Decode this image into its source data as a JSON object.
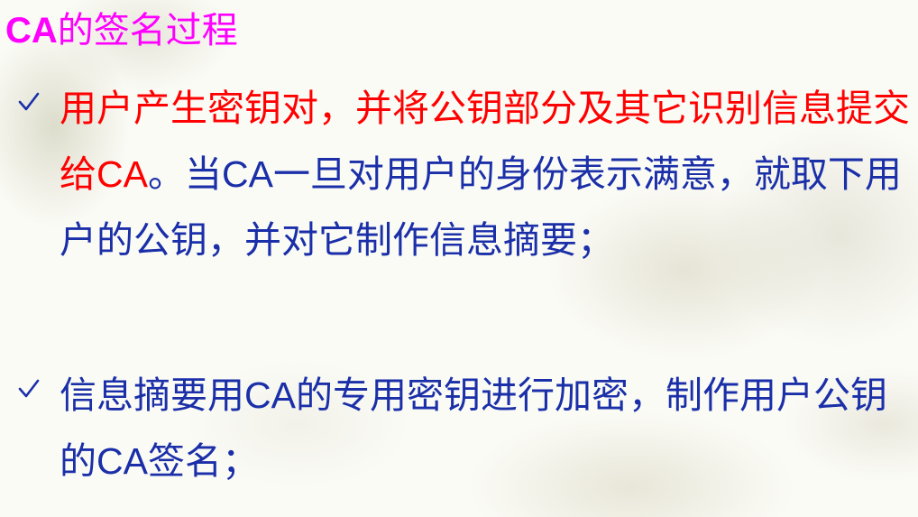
{
  "title": {
    "part1": "CA",
    "part2": "的签名过程"
  },
  "bullets": [
    {
      "segments": [
        {
          "text": "用户产生密钥对，并将公钥部分及其它识别信息提交给",
          "color": "red"
        },
        {
          "text": "CA",
          "color": "red",
          "latin": true
        },
        {
          "text": "。当",
          "color": "blue"
        },
        {
          "text": "CA",
          "color": "blue",
          "latin": true
        },
        {
          "text": "一旦对用户的身份表示满意，就取下用户的公钥，并对它制作信息摘要；",
          "color": "blue"
        }
      ]
    },
    {
      "segments": [
        {
          "text": "信息摘要用",
          "color": "blue"
        },
        {
          "text": "CA",
          "color": "blue",
          "latin": true
        },
        {
          "text": "的专用密钥进行加密，制作用户公钥的",
          "color": "blue"
        },
        {
          "text": "CA",
          "color": "blue",
          "latin": true
        },
        {
          "text": "签名；",
          "color": "blue"
        }
      ]
    }
  ],
  "colors": {
    "title": "#ff00ff",
    "highlight": "#ff0000",
    "body": "#1a2fa8",
    "check": "#1a2fa8"
  },
  "icons": {
    "bullet": "checkmark-icon"
  }
}
